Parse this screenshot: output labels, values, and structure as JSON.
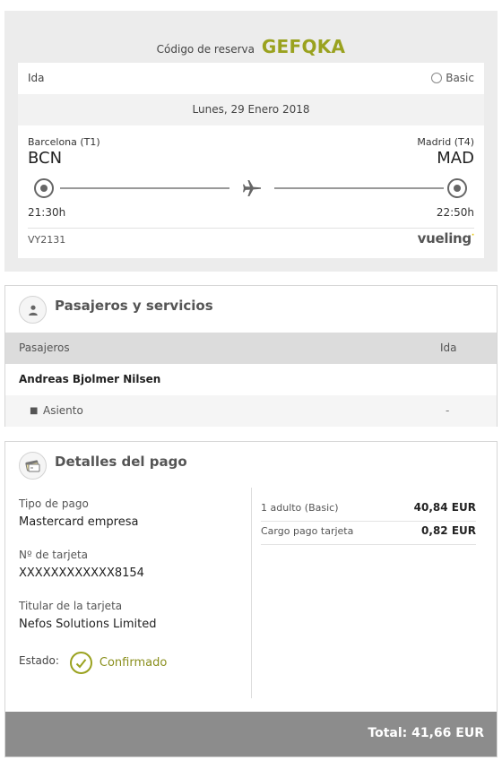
{
  "booking": {
    "code_label": "Código de reserva",
    "code": "GEFQKA",
    "direction": "Ida",
    "fare": "Basic",
    "date": "Lunes, 29 Enero 2018",
    "origin": {
      "airport": "Barcelona (T1)",
      "code": "BCN",
      "time": "21:30h"
    },
    "destination": {
      "airport": "Madrid (T4)",
      "code": "MAD",
      "time": "22:50h"
    },
    "flight_number": "VY2131",
    "airline": "vueling",
    "airline_mark": "·"
  },
  "passengers": {
    "title": "Pasajeros y servicios",
    "col_passengers": "Pasajeros",
    "col_outbound": "Ida",
    "name": "Andreas Bjolmer Nilsen",
    "service_label": "Asiento",
    "service_value": "-"
  },
  "payment": {
    "title": "Detalles del pago",
    "type_label": "Tipo de pago",
    "type_value": "Mastercard empresa",
    "card_label": "Nº de tarjeta",
    "card_value": "XXXXXXXXXXXX8154",
    "holder_label": "Titular de la tarjeta",
    "holder_value": "Nefos Solutions Limited",
    "state_label": "Estado:",
    "state_value": "Confirmado",
    "items": [
      {
        "desc": "1 adulto (Basic)",
        "amount": "40,84 EUR"
      },
      {
        "desc": "Cargo pago tarjeta",
        "amount": "0,82 EUR"
      }
    ],
    "total": "Total: 41,66 EUR"
  },
  "colors": {
    "accent": "#9aa21f",
    "total_bar": "#8c8c8c",
    "header_bg": "#ececec"
  }
}
